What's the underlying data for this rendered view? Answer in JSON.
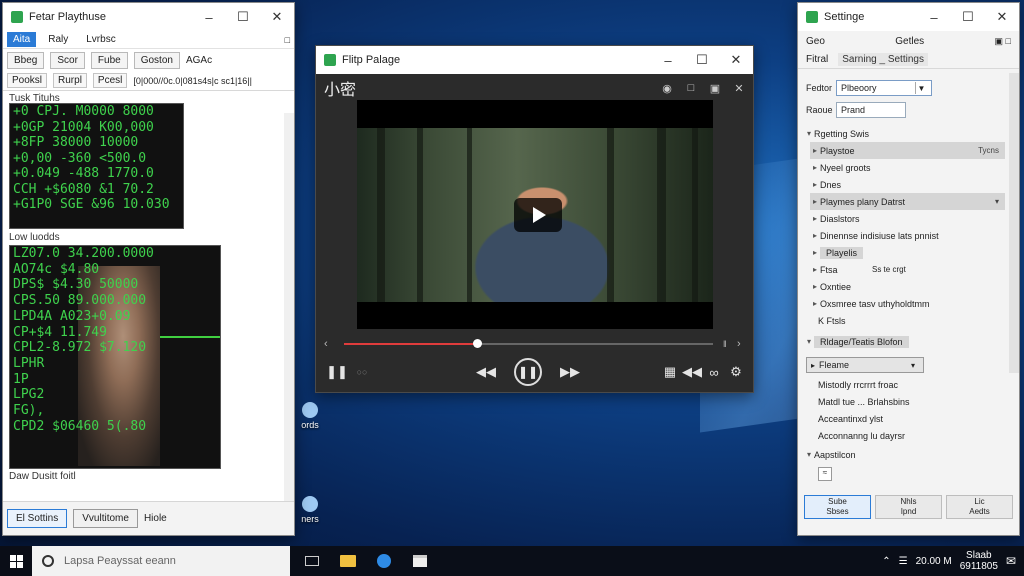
{
  "desktop": {
    "icons": [
      {
        "label": "ords"
      },
      {
        "label": "ners"
      }
    ]
  },
  "left_window": {
    "title": "Fetar Playthuse",
    "menu": [
      "Aita",
      "Raly",
      "Lvrbsc"
    ],
    "toolbar": [
      "Bbeg",
      "Scor",
      "Fube",
      "Goston",
      "AGAc"
    ],
    "toolbar2": [
      "Pooksl",
      "Rurpl",
      "Pcesl",
      "[0|000//0c.0|081s4s|c sc1|16||"
    ],
    "section1_label": "Tusk Tituhs",
    "terminal1_lines": [
      "+0 CPJ. M0000 8000",
      "+0GP 21004 K00,000",
      "+8FP 38000 10000",
      "+0,00 -360 <500.0",
      "+0.049 -488 1770.0",
      "CCH +$6080 &1 70.2",
      "+G1P0 SGE &96 10.030"
    ],
    "section2_label": "Low luodds",
    "terminal2_lines": [
      "LZ07.0 34.200.0000",
      "AO74c  $4.80",
      "DPS$  $4.30 50000",
      "CPS.50 89.000.000",
      "LPD4A  A023+0.09",
      "CP+$4  11.749",
      "CPL2-8.972 $7.120",
      "LPHR",
      "1P",
      "LPG2",
      "FG),",
      "CPD2 $06460 5(.80"
    ],
    "caption": "Daw Dusitt foitl",
    "footer_buttons": [
      "El Sottins",
      "Vvultitome"
    ],
    "footer_text": "Hiole"
  },
  "video_window": {
    "title": "Flitp Palage",
    "heading": "小密",
    "progress": 0.36
  },
  "settings_window": {
    "title": "Settinge",
    "tabs": [
      "Geo",
      "Getles"
    ],
    "subtabs": [
      "Fitral",
      "Sarning _ Settings"
    ],
    "fields": [
      {
        "label": "Fedtor",
        "value": "Plbeoory"
      },
      {
        "label": "Raoue",
        "value": "Prand"
      }
    ],
    "group1_label": "Rgetting Swis",
    "tree_items": [
      {
        "label": "Playstoe",
        "right": "Tycns",
        "highlighted": true
      },
      {
        "label": "Nyeel groots",
        "right": "",
        "highlighted": false
      },
      {
        "label": "Dnes",
        "right": "",
        "highlighted": false
      },
      {
        "label": "Playmes plany Datrst",
        "right": "",
        "highlighted": true
      },
      {
        "label": "Diaslstors",
        "right": "",
        "highlighted": false
      },
      {
        "label": "Dinennse indisiuse lats pnnist",
        "right": "",
        "highlighted": false
      },
      {
        "label": "Playelis",
        "right": "",
        "highlighted": true
      },
      {
        "label": "Ftsa",
        "right": "Ss te crgt",
        "highlighted": false
      },
      {
        "label": "Oxntiee",
        "right": "",
        "highlighted": false
      },
      {
        "label": "Oxsmree tasv uthyholdtmm",
        "right": "",
        "highlighted": false
      }
    ],
    "group2_label": "K Ftsls",
    "group3_label": "Rldage/Teatis Blofon",
    "dropdown2": "Fleame",
    "options": [
      "Mistodly rrcrrrt froac",
      "Matdl tue ... Brlahsbins",
      "Acceantinxd ylst",
      "Acconnanng lu dayrsr"
    ],
    "group4_label": "Aapstilcon",
    "footer_buttons": [
      {
        "line1": "Sube",
        "line2": "Sbses"
      },
      {
        "line1": "Nhls",
        "line2": "Ipnd"
      },
      {
        "line1": "Lic",
        "line2": "Aedts"
      }
    ]
  },
  "taskbar": {
    "search_placeholder": "Lapsa Peayssat eeann",
    "clock_time": "Slaab",
    "clock_date": "6911805",
    "tray_text": "20.00 M"
  }
}
